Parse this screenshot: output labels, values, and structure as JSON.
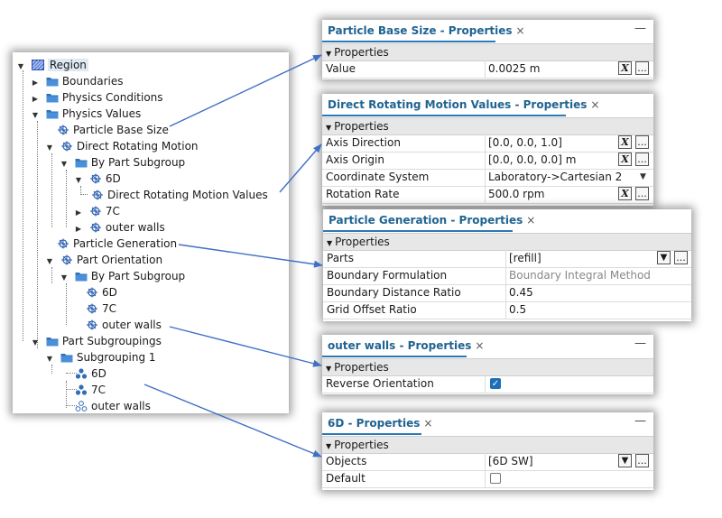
{
  "tree": {
    "region": "Region",
    "boundaries": "Boundaries",
    "physics_conditions": "Physics Conditions",
    "physics_values": "Physics Values",
    "particle_base_size": "Particle Base Size",
    "direct_rotating_motion": "Direct Rotating Motion",
    "by_part_subgroup_1": "By Part Subgroup",
    "drm_6d": "6D",
    "drm_values": "Direct Rotating Motion Values",
    "drm_7c": "7C",
    "drm_outer_walls": "outer walls",
    "particle_generation": "Particle Generation",
    "part_orientation": "Part Orientation",
    "by_part_subgroup_2": "By Part Subgroup",
    "po_6d": "6D",
    "po_7c": "7C",
    "po_outer_walls": "outer walls",
    "part_subgroupings": "Part Subgroupings",
    "subgrouping_1": "Subgrouping 1",
    "sg_6d": "6D",
    "sg_7c": "7C",
    "sg_outer_walls": "outer walls"
  },
  "panels": {
    "pbs": {
      "title": "Particle Base Size - Properties",
      "section": "Properties",
      "rows": [
        {
          "k": "Value",
          "v": "0.0025 m"
        }
      ]
    },
    "drmv": {
      "title": "Direct Rotating Motion Values - Properties",
      "section": "Properties",
      "rows": [
        {
          "k": "Axis Direction",
          "v": "[0.0, 0.0, 1.0]"
        },
        {
          "k": "Axis Origin",
          "v": "[0.0, 0.0, 0.0] m"
        },
        {
          "k": "Coordinate System",
          "v": "Laboratory->Cartesian 2"
        },
        {
          "k": "Rotation Rate",
          "v": "500.0 rpm"
        }
      ]
    },
    "pg": {
      "title": "Particle Generation - Properties",
      "section": "Properties",
      "rows": [
        {
          "k": "Parts",
          "v": "[refill]"
        },
        {
          "k": "Boundary Formulation",
          "v": "Boundary Integral Method"
        },
        {
          "k": "Boundary Distance Ratio",
          "v": "0.45"
        },
        {
          "k": "Grid Offset Ratio",
          "v": "0.5"
        }
      ]
    },
    "ow": {
      "title": "outer walls - Properties",
      "section": "Properties",
      "rows": [
        {
          "k": "Reverse Orientation",
          "checked": true
        }
      ]
    },
    "d6": {
      "title": "6D - Properties",
      "section": "Properties",
      "rows": [
        {
          "k": "Objects",
          "v": "[6D SW]"
        },
        {
          "k": "Default",
          "checked": false
        }
      ]
    }
  },
  "ui": {
    "close_glyph": "×",
    "minimize_glyph": "—",
    "more_glyph": "...",
    "fx_glyph": "X",
    "filter_glyph": "▼"
  },
  "colors": {
    "accent": "#2b78b8",
    "tab_text": "#1f6391",
    "arrow": "#3f6fc6",
    "checkbox": "#1e6fb3"
  }
}
